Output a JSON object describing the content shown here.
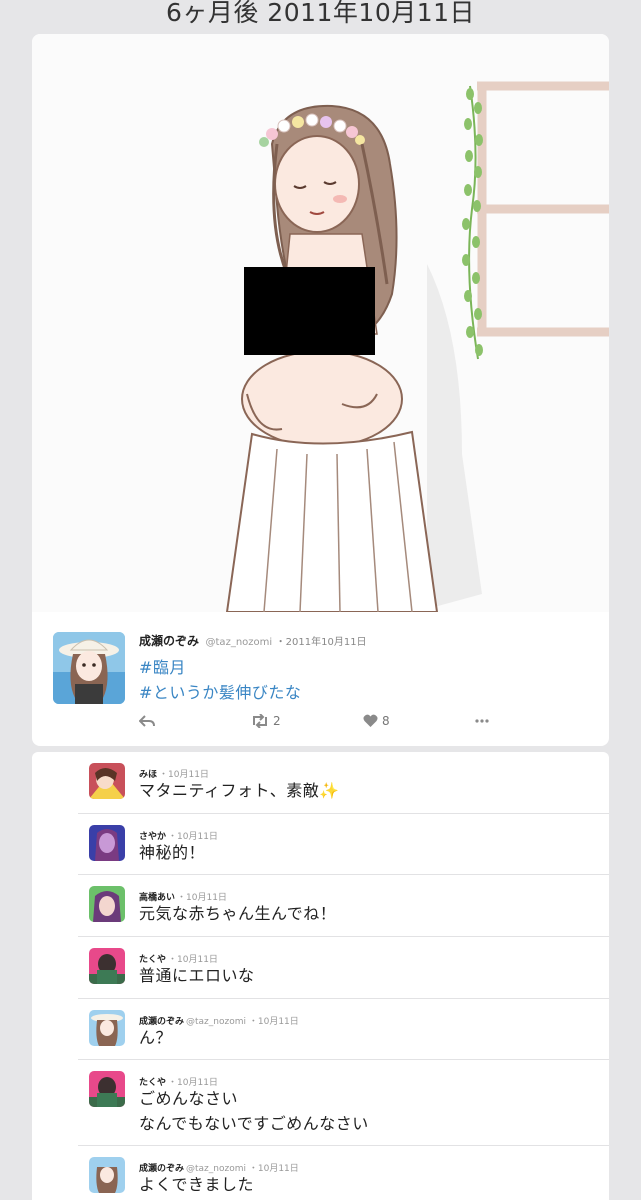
{
  "header": {
    "title": "6ヶ月後 2011年10月11日"
  },
  "post": {
    "author_name": "成瀬のぞみ",
    "author_handle": "@taz_nozomi",
    "date": "・2011年10月11日",
    "hashtags": [
      "#臨月",
      "#というか髪伸びたな"
    ],
    "actions": {
      "retweet_count": "2",
      "like_count": "8"
    },
    "censor_color": "#000000",
    "hashtag_color": "#3a86c4"
  },
  "replies": [
    {
      "name": "みほ",
      "handle": "",
      "date": "・10月11日",
      "text": "マタニティフォト、素敵✨"
    },
    {
      "name": "さやか",
      "handle": "",
      "date": "・10月11日",
      "text": "神秘的！"
    },
    {
      "name": "高橋あい",
      "handle": "",
      "date": "・10月11日",
      "text": "元気な赤ちゃん生んでね！"
    },
    {
      "name": "たくや",
      "handle": "",
      "date": "・10月11日",
      "text": "普通にエロいな"
    },
    {
      "name": "成瀬のぞみ",
      "handle": "@taz_nozomi",
      "date": "・10月11日",
      "text": "ん？"
    },
    {
      "name": "たくや",
      "handle": "",
      "date": "・10月11日",
      "text": "ごめんなさい",
      "text2": "なんでもないですごめんなさい"
    },
    {
      "name": "成瀬のぞみ",
      "handle": "@taz_nozomi",
      "date": "・10月11日",
      "text": "よくできました"
    }
  ]
}
